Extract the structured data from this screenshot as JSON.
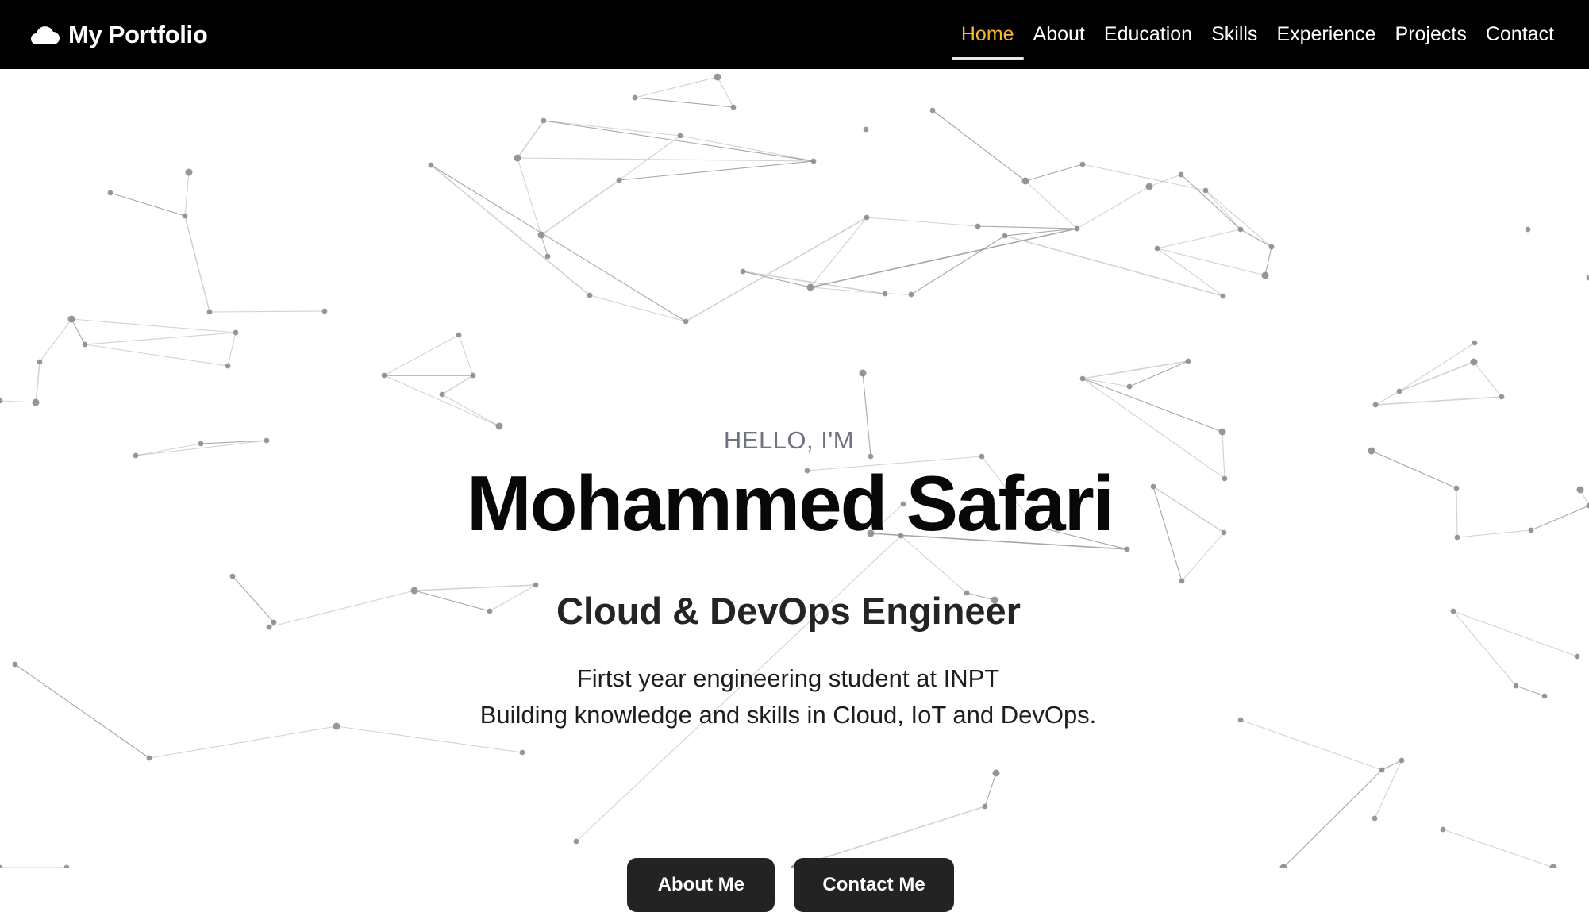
{
  "header": {
    "brand": {
      "icon": "cloud-icon",
      "label": "My Portfolio"
    },
    "nav": [
      {
        "label": "Home",
        "active": true
      },
      {
        "label": "About",
        "active": false
      },
      {
        "label": "Education",
        "active": false
      },
      {
        "label": "Skills",
        "active": false
      },
      {
        "label": "Experience",
        "active": false
      },
      {
        "label": "Projects",
        "active": false
      },
      {
        "label": "Contact",
        "active": false
      }
    ]
  },
  "hero": {
    "greeting": "HELLO, I'M",
    "name": "Mohammed Safari",
    "role": "Cloud & DevOps Engineer",
    "description": [
      "Firtst year engineering student at INPT",
      "Building knowledge and skills in Cloud, IoT and DevOps."
    ],
    "buttons": [
      "About Me",
      "Contact Me"
    ]
  },
  "colors": {
    "navbar_bg": "#000000",
    "active_nav": "#f5b82e",
    "button_bg": "#232323",
    "background": "#ffffff",
    "network_stroke": "#8a8a8a"
  }
}
